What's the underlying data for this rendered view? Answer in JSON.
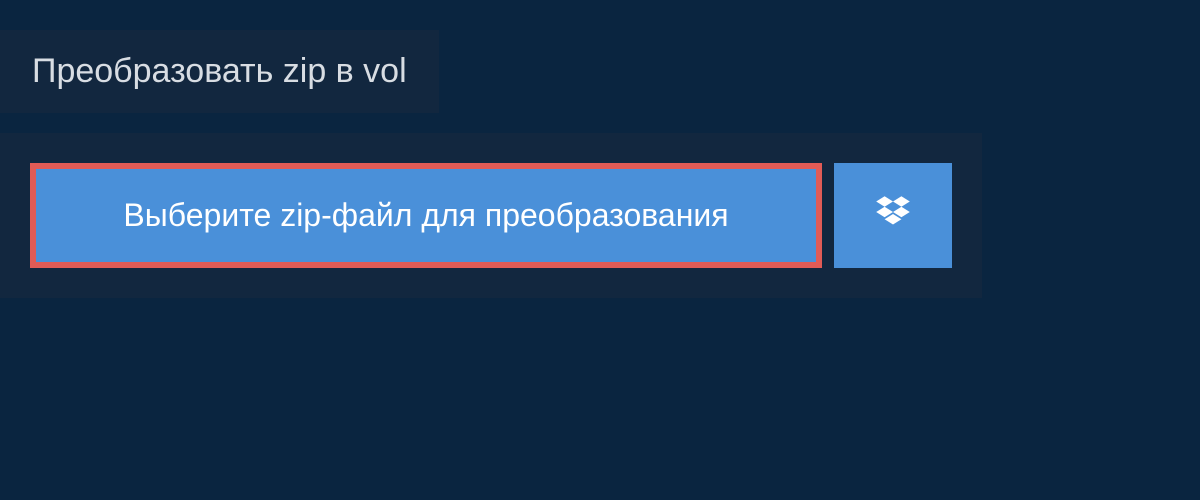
{
  "tab": {
    "title": "Преобразовать zip в vol"
  },
  "upload": {
    "select_file_label": "Выберите zip-файл для преобразования"
  }
}
